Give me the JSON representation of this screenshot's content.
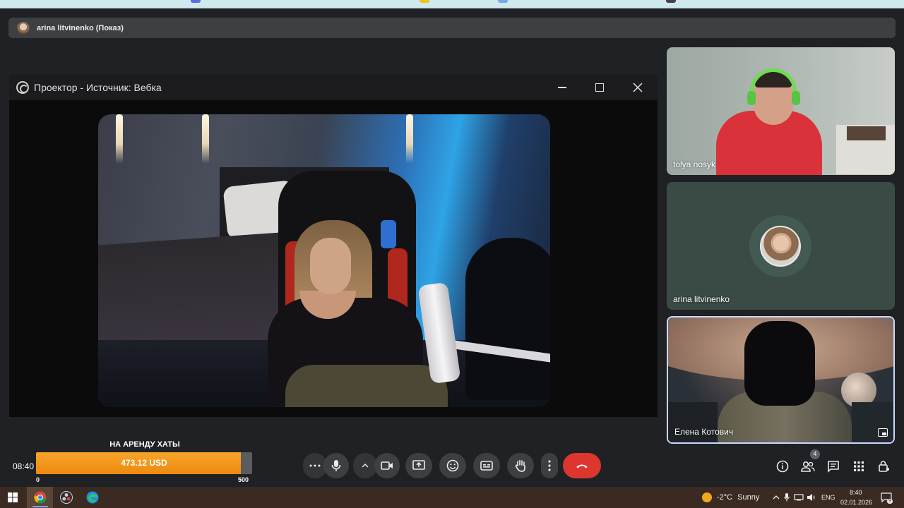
{
  "presentation": {
    "label": "arina litvinenko (Показ)"
  },
  "projector": {
    "title": "Проектор - Источник: Вебка"
  },
  "participants": [
    {
      "name": "tolya nosyk"
    },
    {
      "name": "arina litvinenko"
    },
    {
      "name": "Елена Котович"
    }
  ],
  "donation": {
    "title": "НА АРЕНДУ ХАТЫ",
    "amount_text": "473.12 USD",
    "current": 473.12,
    "min_label": "0",
    "max_label": "500",
    "max": 500,
    "color": "#f39c1f"
  },
  "clock": "08:40",
  "controls": {
    "more_options": "more-horiz-icon",
    "mic": "mic-icon",
    "camera": "videocam-icon",
    "present": "present-screen-icon",
    "emoji": "emoji-icon",
    "captions": "closed-caption-icon",
    "raise_hand": "hand-icon",
    "menu": "more-vert-icon",
    "end_call": "call-end-icon",
    "end_call_color": "#dc362e"
  },
  "side_controls": {
    "info": "info-icon",
    "people": "people-icon",
    "people_count": "4",
    "chat": "chat-icon",
    "activities": "apps-grid-icon",
    "host_controls": "lock-person-icon"
  },
  "taskbar": {
    "weather_temp": "-2°C",
    "weather_desc": "Sunny",
    "language": "ENG",
    "time": "8:40",
    "date": "02.01.2026",
    "notifications": "9"
  }
}
